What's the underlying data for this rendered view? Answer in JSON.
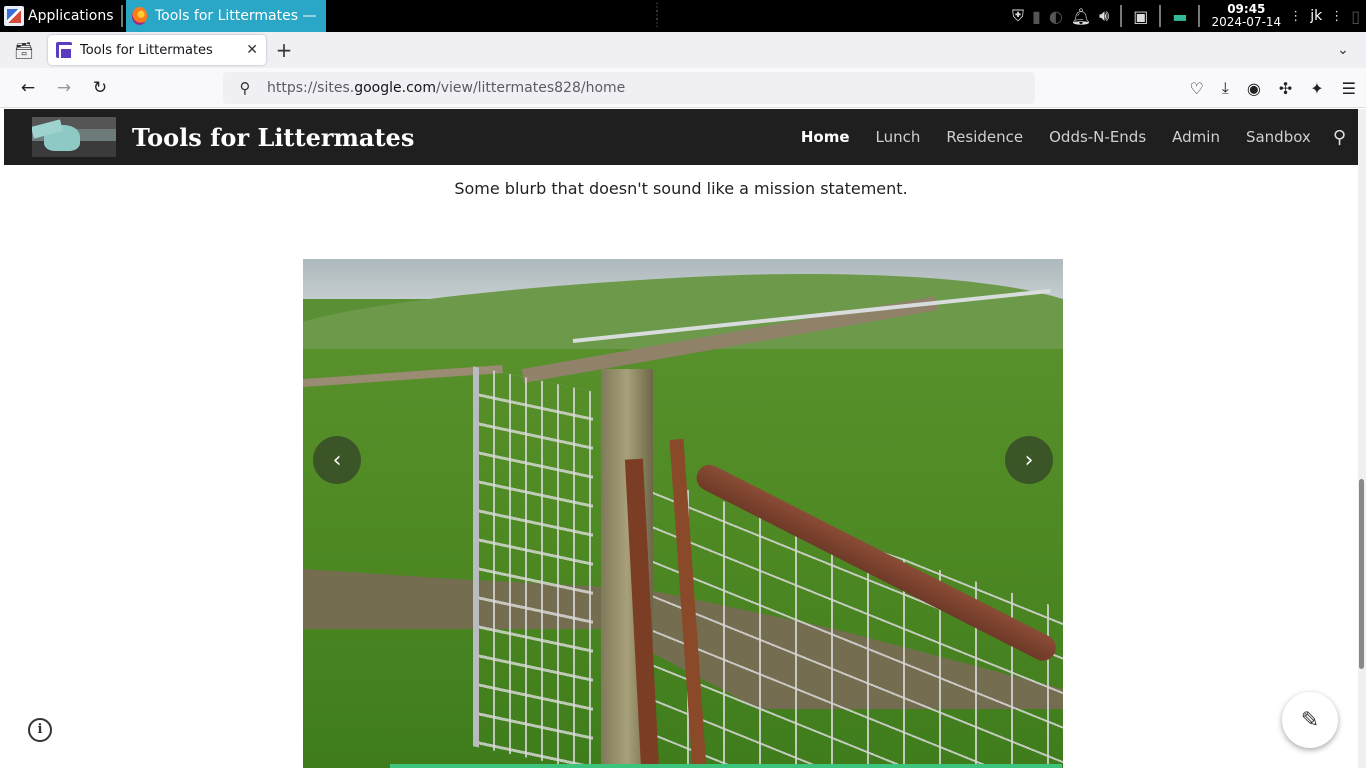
{
  "taskbar": {
    "apps_label": "Applications",
    "task_title": "Tools for Littermates — M…",
    "clock_time": "09:45",
    "clock_date": "2024-07-14",
    "user": "jk"
  },
  "browser": {
    "tab_title": "Tools for Littermates",
    "url_prefix": "https://sites.",
    "url_host": "google.com",
    "url_path": "/view/littermates828/home"
  },
  "site": {
    "title": "Tools for Littermates",
    "nav": [
      "Home",
      "Lunch",
      "Residence",
      "Odds-N-Ends",
      "Admin",
      "Sandbox"
    ],
    "active_nav": "Home"
  },
  "content": {
    "blurb": "Some blurb that doesn't sound like a mission statement."
  },
  "icons": {
    "prev": "chevron-left-icon",
    "next": "chevron-right-icon",
    "info": "info-icon",
    "edit": "pencil-icon"
  },
  "colors": {
    "header_bg": "#1f1f1f",
    "taskbar_active": "#2aa6c6",
    "progress": "#3cc47c"
  }
}
